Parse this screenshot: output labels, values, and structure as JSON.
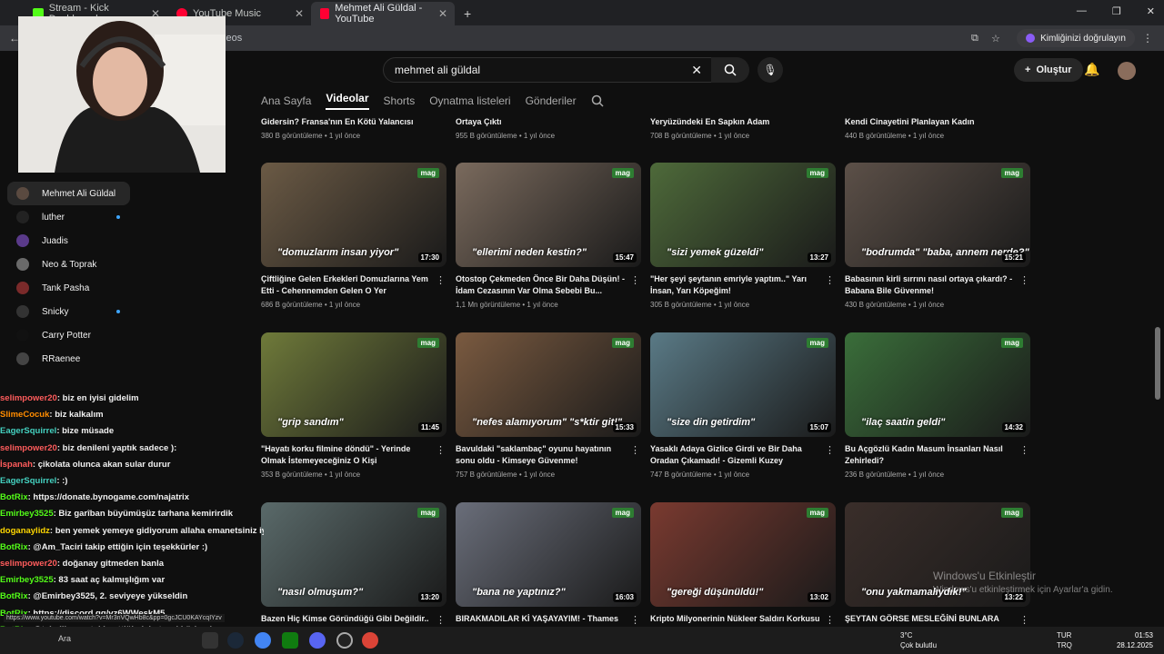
{
  "browser": {
    "tabs": [
      {
        "label": "Stream - Kick Dashboard",
        "color": "#53fc18"
      },
      {
        "label": "YouTube Music",
        "color": "#ff0033"
      },
      {
        "label": "Mehmet Ali Güldal - YouTube",
        "color": "#ff0033"
      }
    ],
    "url": "ideos",
    "verify_label": "Kimliğinizi doğrulayın"
  },
  "yt": {
    "search_value": "mehmet ali güldal",
    "create_label": "Oluştur",
    "channel_tabs": [
      "Ana Sayfa",
      "Videolar",
      "Shorts",
      "Oynatma listeleri",
      "Gönderiler"
    ]
  },
  "top_row": [
    {
      "title": "Gidersin? Fransa'nın En Kötü Yalancısı",
      "meta": "380 B görüntüleme • 1 yıl önce"
    },
    {
      "title": "Ortaya Çıktı",
      "meta": "955 B görüntüleme • 1 yıl önce"
    },
    {
      "title": "Yeryüzündeki En Sapkın Adam",
      "meta": "708 B görüntüleme • 1 yıl önce"
    },
    {
      "title": "Kendi Cinayetini Planlayan Kadın",
      "meta": "440 B görüntüleme • 1 yıl önce"
    }
  ],
  "videos": [
    {
      "title": "Çiftliğine Gelen Erkekleri Domuzlarına Yem Etti - Cehennemden Gelen O Yer",
      "meta": "686 B görüntüleme • 1 yıl önce",
      "dur": "17:30",
      "cap": "\"domuzlarım insan yiyor\"",
      "bg": "#6b5a45"
    },
    {
      "title": "Otostop Çekmeden Önce Bir Daha Düşün! - İdam Cezasının Var Olma Sebebi Bu...",
      "meta": "1,1 Mn görüntüleme • 1 yıl önce",
      "dur": "15:47",
      "cap": "\"ellerimi neden kestin?\"",
      "bg": "#7a6a5d"
    },
    {
      "title": "\"Her şeyi şeytanın emriyle yaptım..\" Yarı İnsan, Yarı Köpeğim!",
      "meta": "305 B görüntüleme • 1 yıl önce",
      "dur": "13:27",
      "cap": "\"sizi yemek güzeldi\"",
      "bg": "#4e6a3a"
    },
    {
      "title": "Babasının kirli sırrını nasıl ortaya çıkardı? - Babana Bile Güvenme!",
      "meta": "430 B görüntüleme • 1 yıl önce",
      "dur": "15:21",
      "cap": "\"bodrumda\" \"baba, annem nerde?\"",
      "bg": "#5c5048"
    },
    {
      "title": "\"Hayatı korku filmine döndü\" - Yerinde Olmak İstemeyeceğiniz O Kişi",
      "meta": "353 B görüntüleme • 1 yıl önce",
      "dur": "11:45",
      "cap": "\"grip sandım\"",
      "bg": "#6f7a3a"
    },
    {
      "title": "Bavuldaki \"saklambaç\" oyunu hayatının sonu oldu - Kimseye Güvenme!",
      "meta": "757 B görüntüleme • 1 yıl önce",
      "dur": "15:33",
      "cap": "\"nefes alamıyorum\" \"s*ktir git!\"",
      "bg": "#7a5a40"
    },
    {
      "title": "Yasaklı Adaya Gizlice Girdi ve Bir Daha Oradan Çıkamadı! - Gizemli Kuzey Sentinel...",
      "meta": "747 B görüntüleme • 1 yıl önce",
      "dur": "15:07",
      "cap": "\"size din getirdim\"",
      "bg": "#5a7a86"
    },
    {
      "title": "Bu Açgözlü Kadın Masum İnsanları Nasıl Zehirledi?",
      "meta": "236 B görüntüleme • 1 yıl önce",
      "dur": "14:32",
      "cap": "\"ilaç saatin geldi\"",
      "bg": "#3a6e3a"
    },
    {
      "title": "Bazen Hiç Kimse Göründüğü Gibi Değildir..",
      "meta": "",
      "dur": "13:20",
      "cap": "\"nasıl olmuşum?\"",
      "bg": "#5a6a6a"
    },
    {
      "title": "BIRAKMADILAR Kİ YAŞAYAYIM! - Thames",
      "meta": "",
      "dur": "16:03",
      "cap": "\"bana ne yaptınız?\"",
      "bg": "#6a6e7a"
    },
    {
      "title": "Kripto Milyonerinin Nükleer Saldırı Korkusu",
      "meta": "",
      "dur": "13:02",
      "cap": "\"gereği düşünüldü!\"",
      "bg": "#7a3a30"
    },
    {
      "title": "ŞEYTAN GÖRSE MESLEĞİNİ BUNLARA",
      "meta": "",
      "dur": "13:22",
      "cap": "\"onu yakmamalıydık!\"",
      "bg": "#3a2e2a"
    }
  ],
  "tag": "mag",
  "subs": [
    {
      "name": "Mehmet Ali Güldal",
      "live": false
    },
    {
      "name": "luther",
      "live": true
    },
    {
      "name": "Juadis",
      "live": false
    },
    {
      "name": "Neo & Toprak",
      "live": false
    },
    {
      "name": "Tank Pasha",
      "live": false
    },
    {
      "name": "Snicky",
      "live": true
    },
    {
      "name": "Carry Potter",
      "live": false
    },
    {
      "name": "RRaenee",
      "live": false
    }
  ],
  "chat": [
    {
      "u": "selimpower20",
      "c": "#ff5c5c",
      "m": ": biz en iyisi gidelim"
    },
    {
      "u": "SlimeCocuk",
      "c": "#ff8c00",
      "m": ": biz kalkalım"
    },
    {
      "u": "EagerSquirrel",
      "c": "#44d1c0",
      "m": ": bize müsade"
    },
    {
      "u": "selimpower20",
      "c": "#ff5c5c",
      "m": ": biz denileni yaptık sadece ):"
    },
    {
      "u": "İspanah",
      "c": "#ff5c5c",
      "m": ": çikolata olunca akan sular durur"
    },
    {
      "u": "EagerSquirrel",
      "c": "#44d1c0",
      "m": ": :)"
    },
    {
      "u": "BotRix",
      "c": "#53fc18",
      "m": ": https://donate.bynogame.com/najatrix"
    },
    {
      "u": "Emirbey3525",
      "c": "#53fc18",
      "m": ": Biz garîban büyümüşüz tarhana kemirirdik"
    },
    {
      "u": "doganaylidz",
      "c": "#ffd700",
      "m": ": ben yemek yemeye gidiyorum allaha emanetsiniz iyi geceler iyi uykular"
    },
    {
      "u": "BotRix",
      "c": "#53fc18",
      "m": ": @Am_Taciri takip ettiğin için teşekkürler :)"
    },
    {
      "u": "selimpower20",
      "c": "#ff5c5c",
      "m": ": doğanay gitmeden banla"
    },
    {
      "u": "Emirbey3525",
      "c": "#53fc18",
      "m": ": 83 saat aç kalmışlığım var"
    },
    {
      "u": "BotRix",
      "c": "#53fc18",
      "m": ": @Emirbey3525, 2. seviyeye yükseldin"
    },
    {
      "u": "BotRix",
      "c": "#53fc18",
      "m": ": https://discord.gg/vz6WWeskM5"
    },
    {
      "u": "BotRix",
      "c": "#53fc18",
      "m": ": @tahailkayyy takip ettiğin için teşekkürler :)"
    }
  ],
  "status_url": "https://www.youtube.com/watch?v=Mr3nVQwHb8c&pp=0gcJCU0KAYcqIYzv",
  "taskbar": {
    "search": "Ara",
    "weather_temp": "3°C",
    "weather_desc": "Çok bulutlu",
    "lang1": "TUR",
    "lang2": "TRQ",
    "time": "01:53",
    "date": "28.12.2025"
  },
  "watermark": {
    "l1": "Windows'u Etkinleştir",
    "l2": "Windows'u etkinleştirmek için Ayarlar'a gidin."
  }
}
